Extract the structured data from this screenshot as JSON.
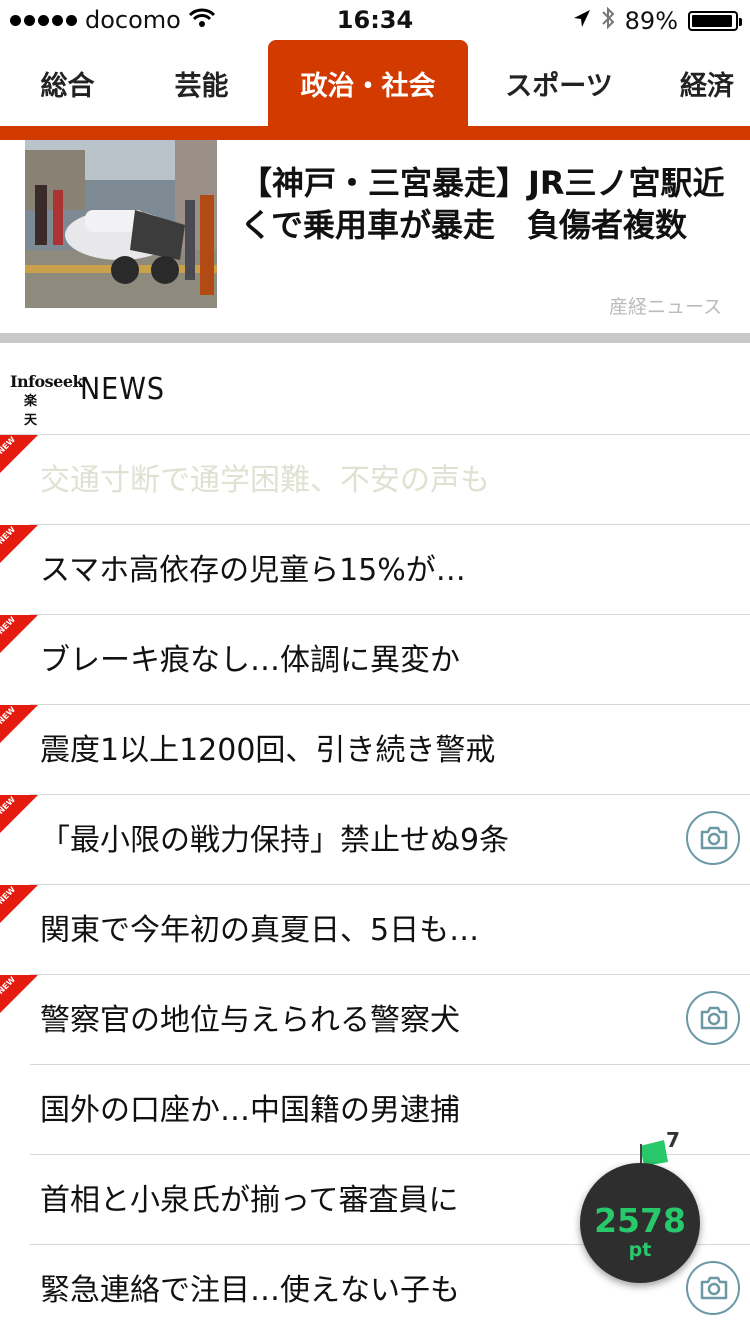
{
  "status_bar": {
    "carrier": "docomo",
    "time": "16:34",
    "battery": "89%"
  },
  "tabs": [
    {
      "label": "総合",
      "active": false
    },
    {
      "label": "芸能",
      "active": false
    },
    {
      "label": "政治・社会",
      "active": true
    },
    {
      "label": "スポーツ",
      "active": false
    },
    {
      "label": "経済",
      "active": false
    }
  ],
  "feature": {
    "headline": "【神戸・三宮暴走】JR三ノ宮駅近くで乗用車が暴走　負傷者複数",
    "source": "産経ニュース"
  },
  "logo": {
    "brand": "Infoseek",
    "sub": "楽天",
    "news": "NEWS"
  },
  "news_items": [
    {
      "title": "交通寸断で通学困難、不安の声も",
      "new": true,
      "camera": false,
      "read": true
    },
    {
      "title": "スマホ高依存の児童ら15%が…",
      "new": true,
      "camera": false,
      "read": false
    },
    {
      "title": "ブレーキ痕なし…体調に異変か",
      "new": true,
      "camera": false,
      "read": false
    },
    {
      "title": "震度1以上1200回、引き続き警戒",
      "new": true,
      "camera": false,
      "read": false
    },
    {
      "title": "「最小限の戦力保持」禁止せぬ9条",
      "new": true,
      "camera": true,
      "read": false
    },
    {
      "title": "関東で今年初の真夏日、5日も…",
      "new": true,
      "camera": false,
      "read": false
    },
    {
      "title": "警察官の地位与えられる警察犬",
      "new": true,
      "camera": true,
      "read": false
    },
    {
      "title": "国外の口座か…中国籍の男逮捕",
      "new": false,
      "camera": false,
      "read": false
    },
    {
      "title": "首相と小泉氏が揃って審査員に",
      "new": false,
      "camera": false,
      "read": false
    },
    {
      "title": "緊急連絡で注目…使えない子も",
      "new": false,
      "camera": true,
      "read": false
    }
  ],
  "new_flag_label": "NEW",
  "points": {
    "value": "2578",
    "unit": "pt",
    "badge": "7"
  },
  "colors": {
    "accent": "#d23a00",
    "new_flag": "#e51b10",
    "points_text": "#27c96a"
  }
}
